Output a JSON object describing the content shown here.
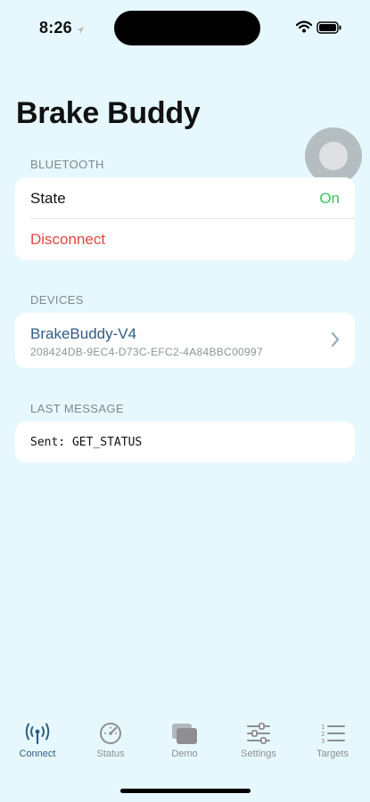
{
  "status_bar": {
    "time": "8:26"
  },
  "app": {
    "title": "Brake Buddy"
  },
  "bluetooth": {
    "header": "BLUETOOTH",
    "state_label": "State",
    "state_value": "On",
    "disconnect_label": "Disconnect"
  },
  "devices": {
    "header": "DEVICES",
    "items": [
      {
        "name": "BrakeBuddy-V4",
        "id": "208424DB-9EC4-D73C-EFC2-4A84BBC00997"
      }
    ]
  },
  "last_message": {
    "header": "LAST MESSAGE",
    "text": "Sent: GET_STATUS"
  },
  "tabs": [
    {
      "label": "Connect",
      "icon": "antenna-icon",
      "active": true
    },
    {
      "label": "Status",
      "icon": "gauge-icon",
      "active": false
    },
    {
      "label": "Demo",
      "icon": "stacked-rectangles-icon",
      "active": false
    },
    {
      "label": "Settings",
      "icon": "sliders-icon",
      "active": false
    },
    {
      "label": "Targets",
      "icon": "numbered-list-icon",
      "active": false
    }
  ],
  "colors": {
    "background": "#e6f8fd",
    "accent": "#2f5d86",
    "state_on": "#34c759",
    "destructive": "#e0463c"
  }
}
